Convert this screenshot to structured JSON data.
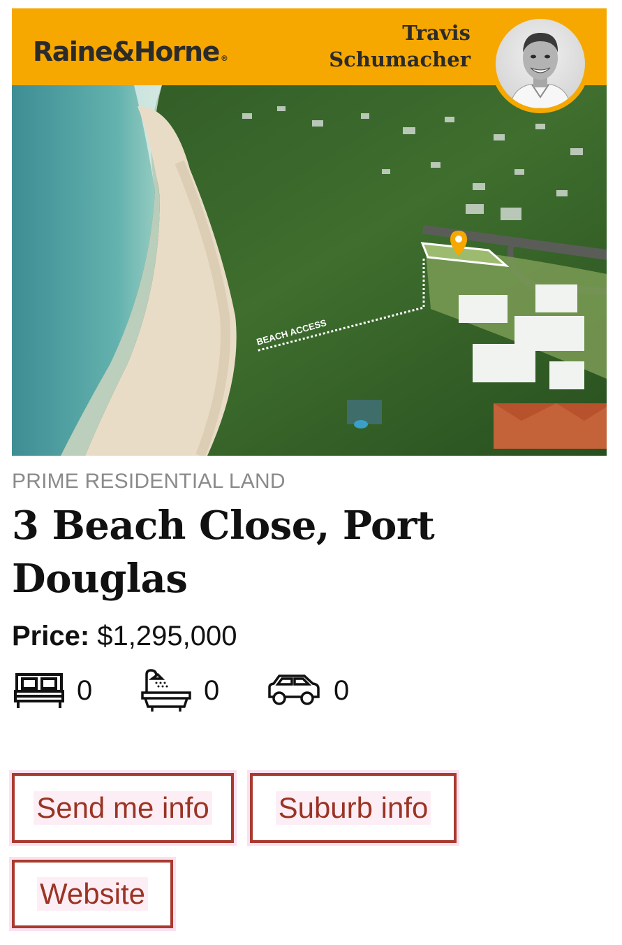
{
  "header": {
    "brand_name": "Raine&Horne",
    "brand_reg": "®",
    "agent_first": "Travis",
    "agent_last": "Schumacher",
    "bg_color": "#f6a800"
  },
  "photo": {
    "overlay_label": "BEACH ACCESS",
    "marker_icon": "location-pin-icon"
  },
  "listing": {
    "category": "PRIME RESIDENTIAL LAND",
    "title": "3 Beach Close, Port Douglas",
    "price_label": "Price:",
    "price_value": "$1,295,000"
  },
  "features": {
    "bedrooms": {
      "icon": "bed-icon",
      "count": "0"
    },
    "bathrooms": {
      "icon": "bath-icon",
      "count": "0"
    },
    "parking": {
      "icon": "car-icon",
      "count": "0"
    }
  },
  "actions": {
    "send_info": "Send me info",
    "suburb_info": "Suburb info",
    "website": "Website",
    "accent_color": "#a83a2e"
  }
}
